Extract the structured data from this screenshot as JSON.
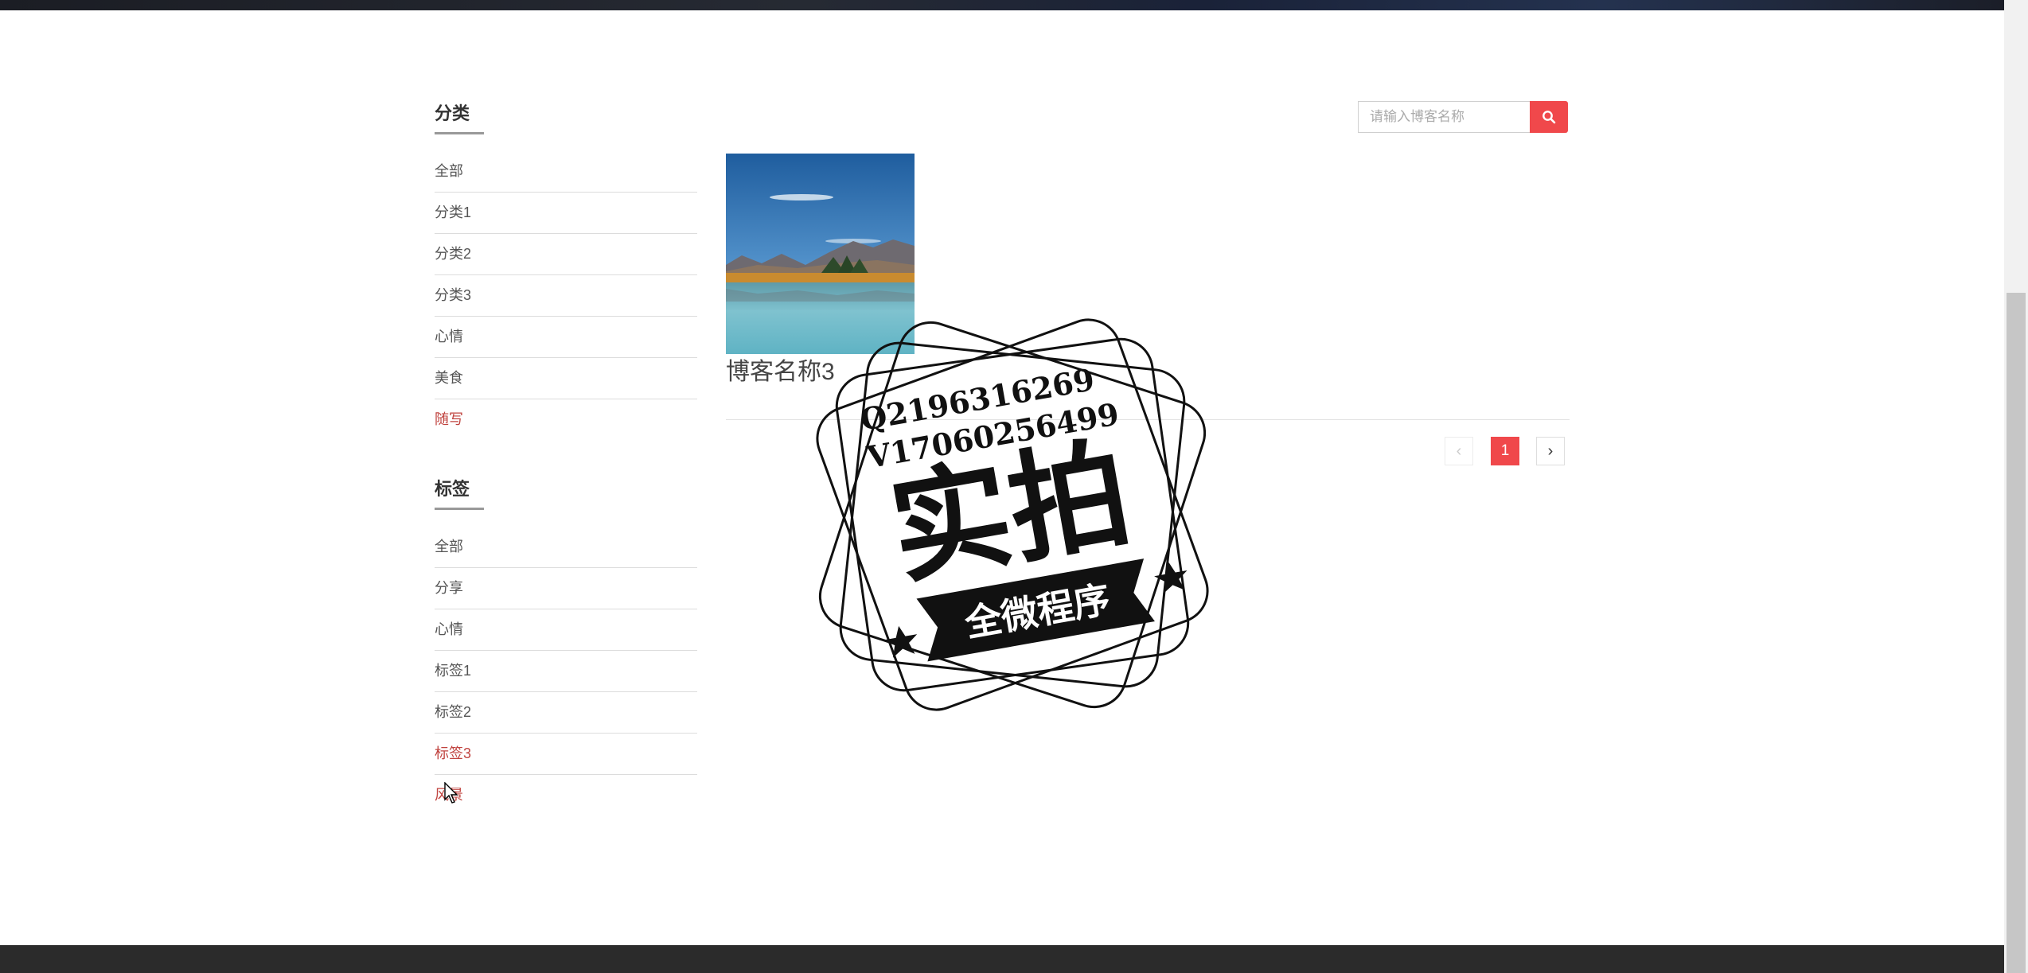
{
  "sidebar": {
    "categories": {
      "title": "分类",
      "items": [
        {
          "label": "全部"
        },
        {
          "label": "分类1"
        },
        {
          "label": "分类2"
        },
        {
          "label": "分类3"
        },
        {
          "label": "心情"
        },
        {
          "label": "美食"
        },
        {
          "label": "随写",
          "active": true
        }
      ]
    },
    "tags": {
      "title": "标签",
      "items": [
        {
          "label": "全部"
        },
        {
          "label": "分享"
        },
        {
          "label": "心情"
        },
        {
          "label": "标签1"
        },
        {
          "label": "标签2"
        },
        {
          "label": "标签3",
          "active": true
        },
        {
          "label": "风景",
          "active": true
        }
      ]
    }
  },
  "search": {
    "placeholder": "请输入博客名称",
    "icon": "search-icon"
  },
  "blogs": [
    {
      "name": "博客名称3"
    }
  ],
  "pagination": {
    "prev": "‹",
    "current": "1",
    "next": "›"
  },
  "watermark": {
    "line1": "Q2196316269",
    "line2": "V17060256499",
    "main": "实拍",
    "ribbon": "全微程序"
  },
  "colors": {
    "accent": "#f0484b",
    "active_link": "#c0433f",
    "footer": "#2b2b2b"
  }
}
